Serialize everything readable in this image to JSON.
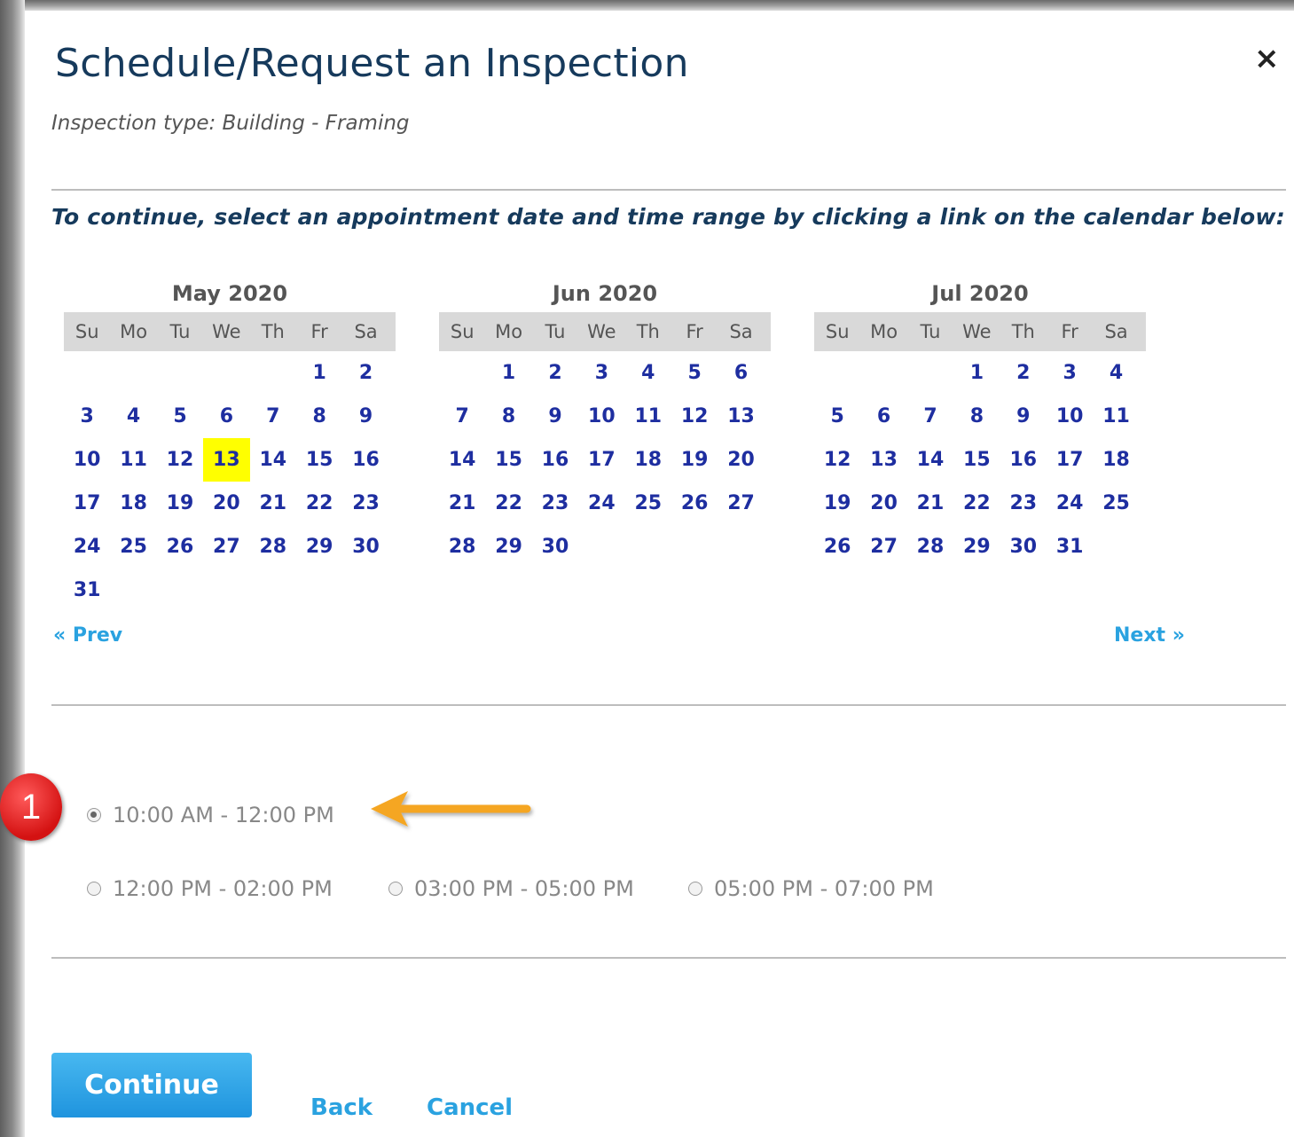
{
  "dialog": {
    "title": "Schedule/Request an Inspection",
    "close_label": "×",
    "subtitle": "Inspection type: Building - Framing",
    "instruction": "To continue, select an appointment date and time range by clicking a link on the calendar below:"
  },
  "calendar": {
    "weekdays": [
      "Su",
      "Mo",
      "Tu",
      "We",
      "Th",
      "Fr",
      "Sa"
    ],
    "selected_month": 0,
    "selected_day": "13",
    "highlight_color": "#ffff00",
    "months": [
      {
        "title": "May 2020",
        "weeks": [
          [
            "",
            "",
            "",
            "",
            "",
            "1",
            "2"
          ],
          [
            "3",
            "4",
            "5",
            "6",
            "7",
            "8",
            "9"
          ],
          [
            "10",
            "11",
            "12",
            "13",
            "14",
            "15",
            "16"
          ],
          [
            "17",
            "18",
            "19",
            "20",
            "21",
            "22",
            "23"
          ],
          [
            "24",
            "25",
            "26",
            "27",
            "28",
            "29",
            "30"
          ],
          [
            "31",
            "",
            "",
            "",
            "",
            "",
            ""
          ]
        ]
      },
      {
        "title": "Jun 2020",
        "weeks": [
          [
            "",
            "1",
            "2",
            "3",
            "4",
            "5",
            "6"
          ],
          [
            "7",
            "8",
            "9",
            "10",
            "11",
            "12",
            "13"
          ],
          [
            "14",
            "15",
            "16",
            "17",
            "18",
            "19",
            "20"
          ],
          [
            "21",
            "22",
            "23",
            "24",
            "25",
            "26",
            "27"
          ],
          [
            "28",
            "29",
            "30",
            "",
            "",
            "",
            ""
          ]
        ]
      },
      {
        "title": "Jul 2020",
        "weeks": [
          [
            "",
            "",
            "",
            "1",
            "2",
            "3",
            "4"
          ],
          [
            "5",
            "6",
            "7",
            "8",
            "9",
            "10",
            "11"
          ],
          [
            "12",
            "13",
            "14",
            "15",
            "16",
            "17",
            "18"
          ],
          [
            "19",
            "20",
            "21",
            "22",
            "23",
            "24",
            "25"
          ],
          [
            "26",
            "27",
            "28",
            "29",
            "30",
            "31",
            ""
          ]
        ]
      }
    ],
    "prev_label": "« Prev",
    "next_label": "Next »"
  },
  "time_slots": [
    {
      "label": "10:00 AM - 12:00 PM",
      "selected": true
    },
    {
      "label": "12:00 PM - 02:00 PM",
      "selected": false
    },
    {
      "label": "03:00 PM - 05:00 PM",
      "selected": false
    },
    {
      "label": "05:00 PM - 07:00 PM",
      "selected": false
    }
  ],
  "annotation": {
    "badge_number": "1",
    "badge_color": "#e01818",
    "arrow_color": "#f5a623"
  },
  "actions": {
    "continue_label": "Continue",
    "back_label": "Back",
    "cancel_label": "Cancel"
  },
  "colors": {
    "title": "#163a5c",
    "link": "#2aa2e0",
    "day_link": "#1e2ea0",
    "button": "#2aa2e0"
  }
}
